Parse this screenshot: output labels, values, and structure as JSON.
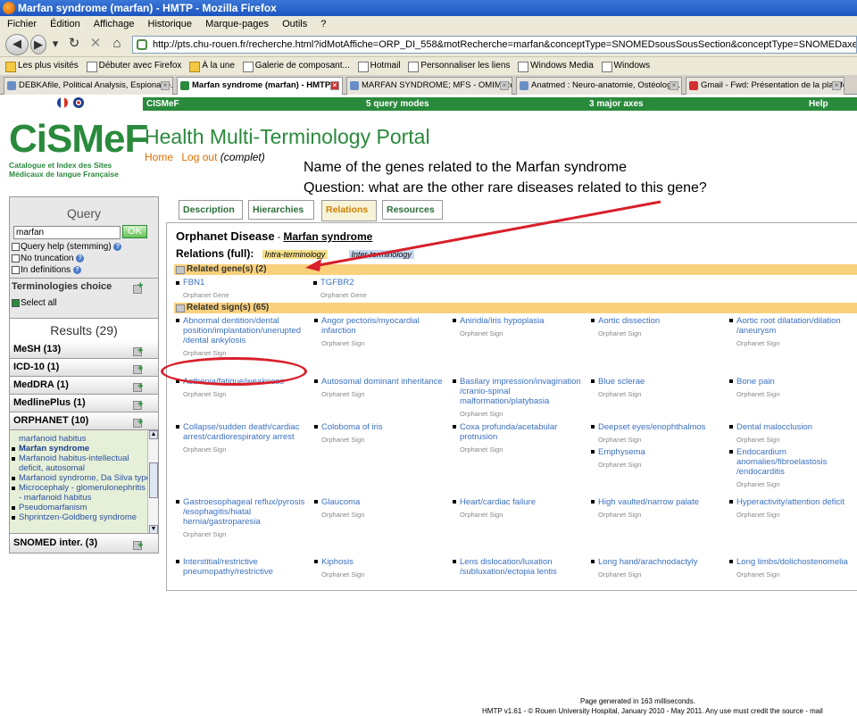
{
  "window": {
    "title": "Marfan syndrome (marfan) - HMTP - Mozilla Firefox"
  },
  "menu": [
    "Fichier",
    "Édition",
    "Affichage",
    "Historique",
    "Marque-pages",
    "Outils",
    "?"
  ],
  "address": {
    "url": "http://pts.chu-rouen.fr/recherche.html?idMotAffiche=ORP_DI_558&motRecherche=marfan&conceptType=SNOMEDsousSousSection&conceptType=SNOMEDaxe&conceptType=SNOMEDchapitre&conceptType=SNOM"
  },
  "bookmarks": [
    "Les plus visités",
    "Débuter avec Firefox",
    "À la une",
    "Galerie de composant...",
    "Hotmail",
    "Personnaliser les liens",
    "Windows Media",
    "Windows"
  ],
  "tabs": [
    {
      "label": "DEBKAfile, Political Analysis, Espionage..."
    },
    {
      "label": "Marfan syndrome (marfan) - HMTP"
    },
    {
      "label": "MARFAN SYNDROME; MFS - OMIM Result"
    },
    {
      "label": "Anatmed : Neuro-anatomie, Ostéologie..."
    },
    {
      "label": "Gmail - Fwd: Présentation de la platefo..."
    }
  ],
  "topbar": {
    "left": "CISMeF",
    "center": "5 query modes",
    "axes": "3 major axes",
    "help": "Help"
  },
  "logo": {
    "text": "CiSMeF",
    "subtitle": "Catalogue et Index des Sites Médicaux de langue Française"
  },
  "portal_title": "Health Multi-Terminology Portal",
  "nav": {
    "home": "Home",
    "logout": "Log out",
    "mode": "(complet)"
  },
  "annotation": {
    "line1": "Name of the genes related to the Marfan syndrome",
    "line2": "Question: what are the other rare diseases related to this gene?"
  },
  "query": {
    "title": "Query",
    "value": "marfan",
    "ok": "OK",
    "opt1": "Query help (stemming)",
    "opt2": "No truncation",
    "opt3": "In definitions",
    "term_choice": "Terminologies choice",
    "select_all": "Select all"
  },
  "results": {
    "title": "Results (29)",
    "rows": [
      "MeSH (13)",
      "ICD-10 (1)",
      "MedDRA (1)",
      "MedlinePlus (1)",
      "ORPHANET (10)"
    ],
    "orphanet_items": [
      "marfanoid habitus",
      "Marfan syndrome",
      "Marfanoid habitus-intellectual",
      "deficit, autosomal",
      "Marfanoid syndrome, Da Silva type",
      "Microcephaly - glomerulonephritis",
      "- marfanoid habitus",
      "Pseudomarfanism",
      "Shprintzen-Goldberg syndrome"
    ],
    "snomed": "SNOMED inter. (3)"
  },
  "content_tabs": [
    "Description",
    "Hierarchies",
    "Relations",
    "Resources"
  ],
  "disease": {
    "type": "Orphanet Disease",
    "sep": " - ",
    "name": "Marfan syndrome",
    "relations_label": "Relations (full):",
    "intra": "Intra-terminology",
    "inter": "Inter-terminology"
  },
  "genes": {
    "header": "Related gene(s) (2)",
    "items": [
      {
        "name": "FBN1",
        "type": "Orphanet Gene"
      },
      {
        "name": "TGFBR2",
        "type": "Orphanet Gene"
      }
    ]
  },
  "signs": {
    "header": "Related sign(s) (65)",
    "type": "Orphanet Sign",
    "items": [
      "Abnormal dentition/dental position/implantation/unerupted /dental ankylosis",
      "Angor pectoris/myocardial infarction",
      "Aniridia/iris hypoplasia",
      "Aortic dissection",
      "Aortic root dilatation/dilation /aneurysm",
      "Asthenia/fatigue/weakness",
      "Autosomal dominant inheritance",
      "Basilary impression/invagination /cranio-spinal malformation/platybasia",
      "Blue sclerae",
      "Bone pain",
      "Collapse/sudden death/cardiac arrest/cardiorespiratory arrest",
      "Coloboma of iris",
      "Coxa profunda/acetabular protrusion",
      "Deepset eyes/enophthalmos",
      "Dental malocclusion",
      "Emphysema",
      "Endocardium anomalies/fibroelastosis /endocarditis",
      "Gastroesophageal reflux/pyrosis /esophagitis/hiatal hernia/gastroparesia",
      "Glaucoma",
      "Heart/cardiac failure",
      "High vaulted/narrow palate",
      "Hyperactivity/attention deficit",
      "Interstitial/restrictive pneumopathy/restrictive",
      "Kiphosis",
      "Lens dislocation/luxation /subluxation/ectopia lentis",
      "Long hand/arachnodactyly",
      "Long limbs/dolichostenomelia"
    ]
  },
  "footer": {
    "line1": "Page generated in 163 milliseconds.",
    "line2": "HMTP v1.61 - © Rouen University Hospital, January 2010 - May 2011. Any use must credit the source - mail"
  },
  "colors": {
    "green": "#2a8a3c",
    "orange_header": "#f9d17c",
    "annotation_red": "#d81f2a",
    "link": "#3a70c0"
  }
}
